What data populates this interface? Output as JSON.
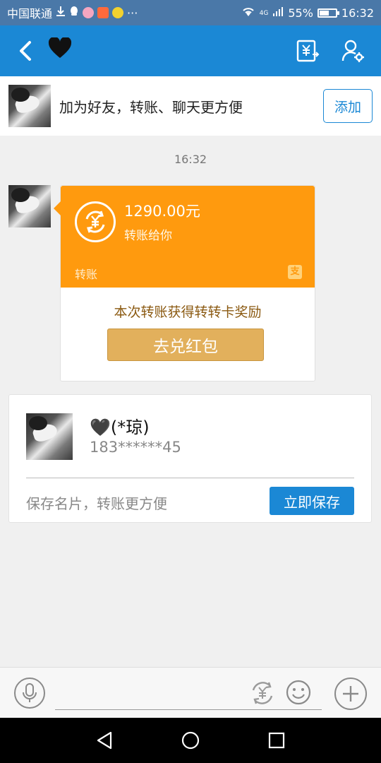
{
  "status_bar": {
    "carrier": "中国联通",
    "network": "4G",
    "battery": "55%",
    "battery_level": 0.55,
    "time": "16:32"
  },
  "header": {
    "title_icon": "black-heart-emoji",
    "transfer_icon": "yuan-transfer-icon",
    "settings_icon": "user-settings-icon"
  },
  "banner": {
    "text": "加为好友，转账、聊天更方便",
    "add_label": "添加"
  },
  "chat": {
    "timestamp": "16:32",
    "transfer": {
      "amount": "1290.00元",
      "description": "转账给你",
      "label": "转账",
      "reward_text": "本次转账获得转转卡奖励",
      "redeem_label": "去兑红包",
      "accent_color": "#ff9a0e"
    },
    "contact_card": {
      "name": "🖤(*琼)",
      "phone": "183******45",
      "hint": "保存名片，转账更方便",
      "save_label": "立即保存"
    }
  },
  "input_bar": {
    "mic_icon": "microphone-icon",
    "transfer_icon": "yuan-transfer-icon",
    "emoji_icon": "smiley-icon",
    "more_icon": "plus-icon"
  },
  "colors": {
    "primary": "#1b88d5",
    "transfer_orange": "#ff9a0e",
    "redeem_gold": "#e2b05c"
  }
}
